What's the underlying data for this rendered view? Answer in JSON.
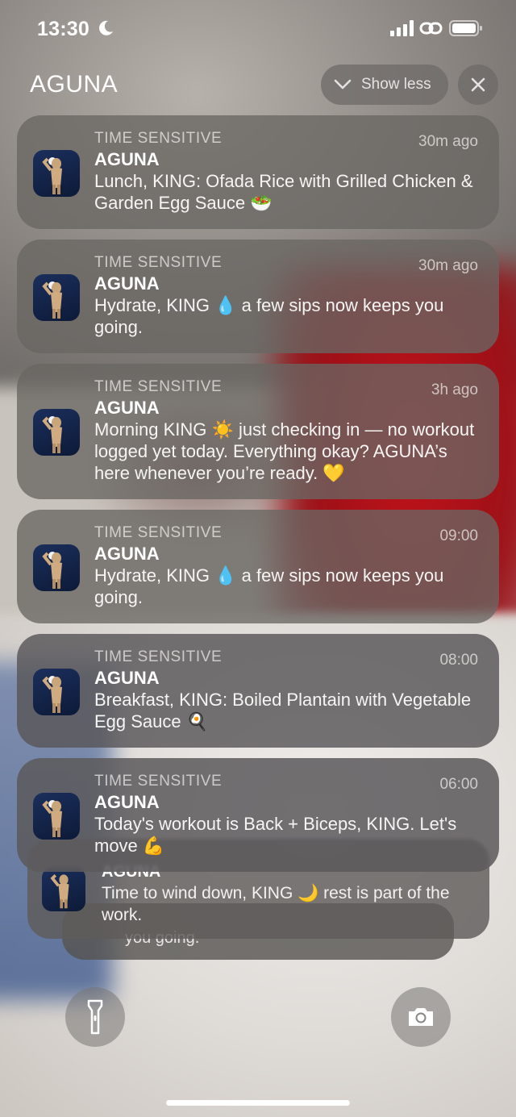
{
  "status_bar": {
    "time": "13:30"
  },
  "header": {
    "app_title": "AGUNA",
    "show_less_label": "Show less"
  },
  "notifications": [
    {
      "label": "TIME SENSITIVE",
      "app": "AGUNA",
      "time": "30m ago",
      "message": "Lunch, KING: Ofada Rice with Grilled Chicken & Garden Egg Sauce 🥗"
    },
    {
      "label": "TIME SENSITIVE",
      "app": "AGUNA",
      "time": "30m ago",
      "message": "Hydrate, KING 💧 a few sips now keeps you going."
    },
    {
      "label": "TIME SENSITIVE",
      "app": "AGUNA",
      "time": "3h ago",
      "message": "Morning KING ☀️ just checking in — no workout logged yet today. Everything okay? AGUNA’s here whenever you’re ready. 💛"
    },
    {
      "label": "TIME SENSITIVE",
      "app": "AGUNA",
      "time": "09:00",
      "message": "Hydrate, KING 💧 a few sips now keeps you going."
    },
    {
      "label": "TIME SENSITIVE",
      "app": "AGUNA",
      "time": "08:00",
      "message": "Breakfast, KING: Boiled Plantain with Vegetable Egg Sauce 🍳"
    },
    {
      "label": "TIME SENSITIVE",
      "app": "AGUNA",
      "time": "06:00",
      "message": "Today's workout is Back + Biceps, KING. Let's move 💪"
    }
  ],
  "stacked": [
    {
      "app": "AGUNA",
      "message": "Time to wind down, KING 🌙 rest is part of the work."
    },
    {
      "message": "you going."
    }
  ],
  "icons": {
    "flashlight": "flashlight-icon",
    "camera": "camera-icon",
    "close": "close-icon",
    "chevron": "chevron-down-icon"
  }
}
